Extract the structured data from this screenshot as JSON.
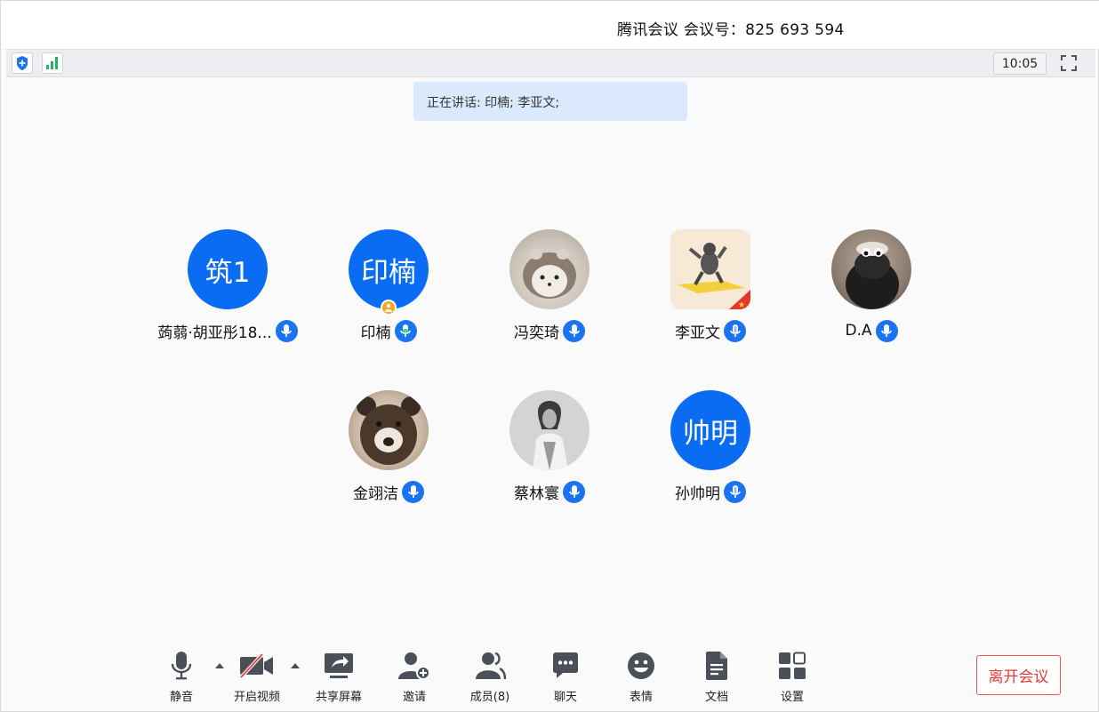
{
  "window": {
    "title": "腾讯会议 会议号：825 693 594"
  },
  "statusbar": {
    "time": "10:05",
    "icons": [
      "shield-icon",
      "signal-icon",
      "fullscreen-icon"
    ]
  },
  "speaking_banner": "正在讲话: 印楠; 李亚文;",
  "participants": [
    {
      "name": "蒟蒻·胡亚彤18...",
      "avatar_text": "筑1",
      "mic": "active"
    },
    {
      "name": "印楠",
      "avatar_text": "印楠",
      "mic": "active-green",
      "host": true
    },
    {
      "name": "冯奕琦",
      "avatar_text": "",
      "avatar_icon": "hedgehog-photo",
      "mic": "active"
    },
    {
      "name": "李亚文",
      "avatar_text": "",
      "avatar_icon": "toy-figure-photo",
      "mic": "speaking"
    },
    {
      "name": "D.A",
      "avatar_text": "",
      "avatar_icon": "sheep-plush-photo",
      "mic": "active"
    },
    {
      "name": "金翊洁",
      "avatar_text": "",
      "avatar_icon": "bear-plush-photo",
      "mic": "active"
    },
    {
      "name": "蔡林寰",
      "avatar_text": "",
      "avatar_icon": "person-photo",
      "mic": "active"
    },
    {
      "name": "孙帅明",
      "avatar_text": "帅明",
      "mic": "speaking"
    }
  ],
  "toolbar": {
    "mute": "静音",
    "video": "开启视频",
    "share": "共享屏幕",
    "invite": "邀请",
    "members": "成员(8)",
    "chat": "聊天",
    "emoji": "表情",
    "docs": "文档",
    "settings": "设置",
    "leave": "离开会议"
  },
  "colors": {
    "accent": "#0a6cf2",
    "banner": "#dbe9fc",
    "leave": "#e23b3b"
  }
}
